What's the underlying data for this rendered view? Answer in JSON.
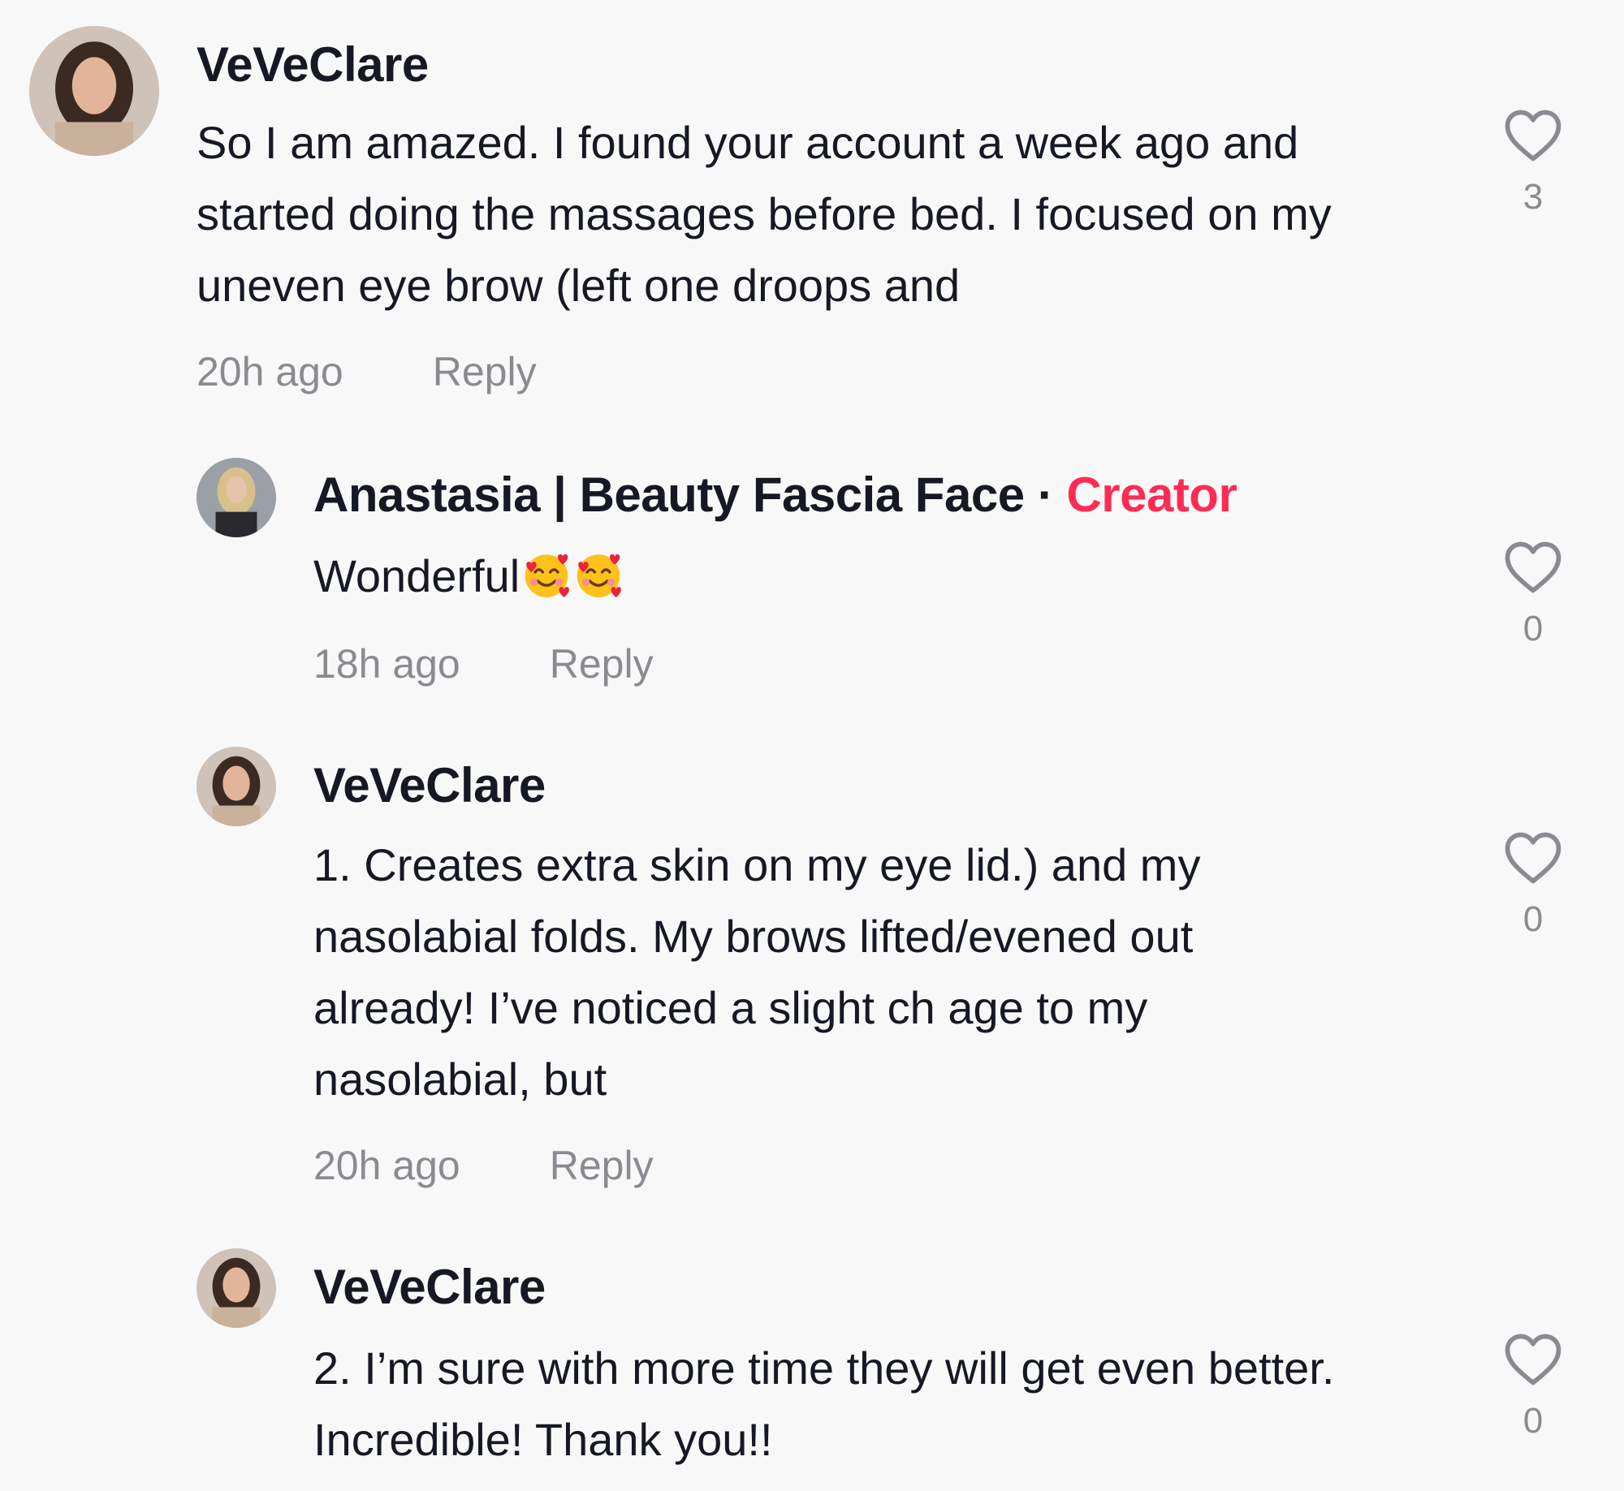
{
  "comments": [
    {
      "username": "VeVeClare",
      "text": "So I am amazed. I found your account a week ago and started doing the massages before bed. I focused on my uneven eye brow (left one droops and",
      "time": "20h ago",
      "reply_label": "Reply",
      "likes": "3"
    },
    {
      "username": "Anastasia | Beauty Fascia Face",
      "separator": "·",
      "badge": "Creator",
      "text": "Wonderful",
      "emoji": [
        "smiling-face-with-hearts",
        "smiling-face-with-hearts"
      ],
      "time": "18h ago",
      "reply_label": "Reply",
      "likes": "0"
    },
    {
      "username": "VeVeClare",
      "text": "1. Creates extra skin on my eye lid.) and my nasolabial folds. My brows lifted/evened out already! I’ve noticed a slight ch age to my nasolabial, but",
      "time": "20h ago",
      "reply_label": "Reply",
      "likes": "0"
    },
    {
      "username": "VeVeClare",
      "text": "2. I’m sure with more time they will get even better. Incredible! Thank you!!",
      "likes": "0"
    }
  ],
  "colors": {
    "background": "#f8f8f8",
    "text": "#161823",
    "muted": "#8a8b91",
    "creator_badge": "#fe2c55"
  }
}
